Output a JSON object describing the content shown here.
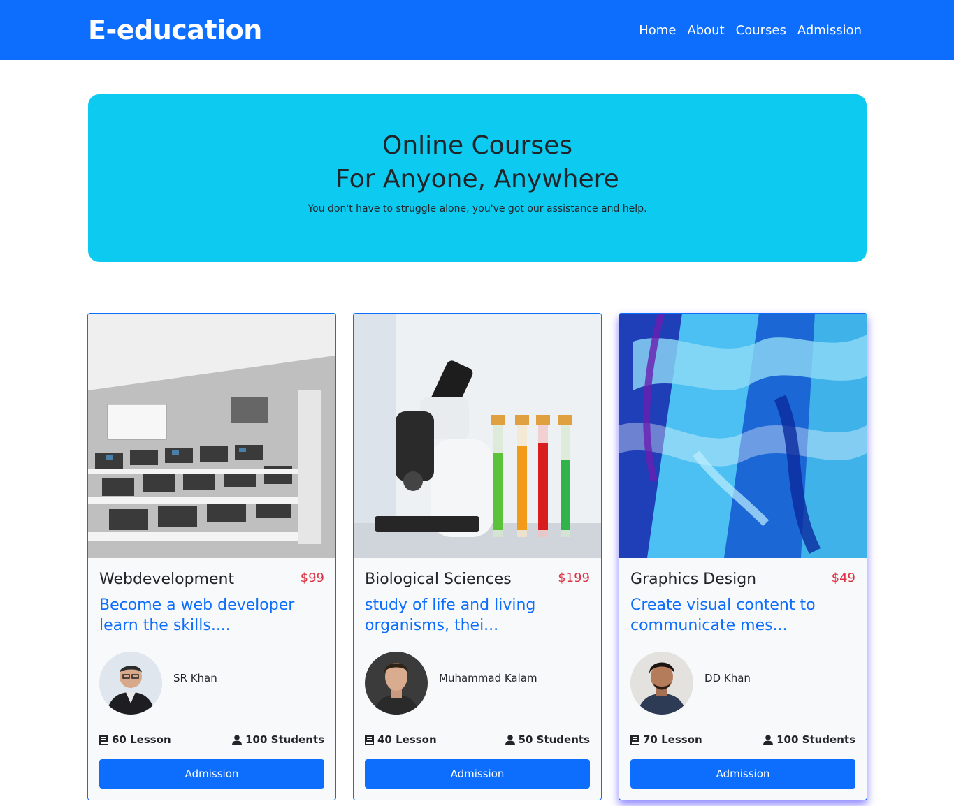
{
  "navbar": {
    "brand": "E-education",
    "links": [
      "Home",
      "About",
      "Courses",
      "Admission"
    ]
  },
  "hero": {
    "title_line1": "Online Courses",
    "title_line2": "For Anyone, Anywhere",
    "subtitle": "You don't have to struggle alone, you've got our assistance and help."
  },
  "courses": [
    {
      "title": "Webdevelopment",
      "price": "$99",
      "description": "Become a web developer learn the skills....",
      "instructor": "SR Khan",
      "lessons": "60 Lesson",
      "students": "100 Students",
      "button": "Admission"
    },
    {
      "title": "Biological Sciences",
      "price": "$199",
      "description": "study of life and living organisms, thei...",
      "instructor": "Muhammad Kalam",
      "lessons": "40 Lesson",
      "students": "50 Students",
      "button": "Admission"
    },
    {
      "title": "Graphics Design",
      "price": "$49",
      "description": "Create visual content to communicate mes...",
      "instructor": "DD Khan",
      "lessons": "70 Lesson",
      "students": "100 Students",
      "button": "Admission"
    }
  ],
  "icons": {
    "lessons": "book-icon",
    "students": "user-icon"
  },
  "colors": {
    "primary": "#0d6efd",
    "hero_bg": "#0dcaf0",
    "price": "#dc3545",
    "card_bg": "#f8f9fa"
  }
}
